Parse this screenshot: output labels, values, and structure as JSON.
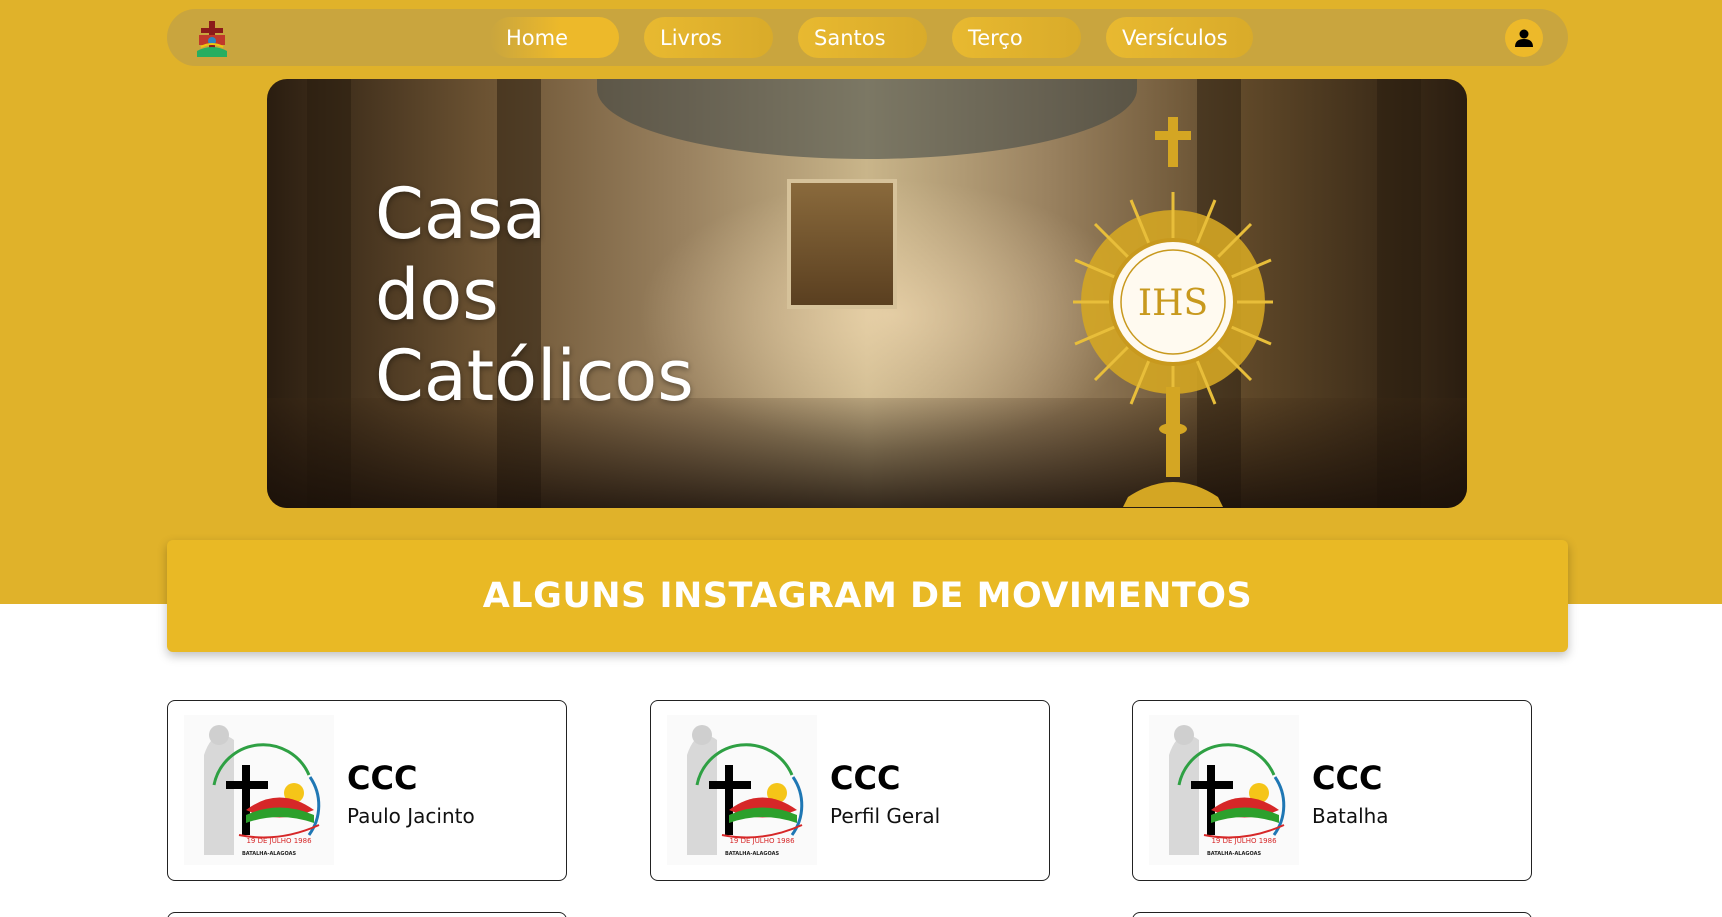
{
  "nav": {
    "logo_icon": "cross-emblem-icon",
    "links": [
      {
        "label": "Home"
      },
      {
        "label": "Livros"
      },
      {
        "label": "Santos"
      },
      {
        "label": "Terço"
      },
      {
        "label": "Versículos"
      }
    ],
    "user_icon": "user-icon"
  },
  "hero": {
    "title_lines": [
      "Casa",
      "dos",
      "Católicos"
    ],
    "monstrance_text": "IHS"
  },
  "section": {
    "title": "ALGUNS INSTAGRAM DE MOVIMENTOS"
  },
  "cards": [
    {
      "title": "CCC",
      "subtitle": "Paulo Jacinto",
      "logo_icon": "caminhada-comunitaria-logo"
    },
    {
      "title": "CCC",
      "subtitle": "Perfil Geral",
      "logo_icon": "caminhada-comunitaria-logo"
    },
    {
      "title": "CCC",
      "subtitle": "Batalha",
      "logo_icon": "caminhada-comunitaria-logo"
    }
  ],
  "logo_text": {
    "arc": "CAMINHADA COMUNITÁRIA COM CRISTO",
    "date": "19 DE JULHO 1986",
    "place": "BATALHA-ALAGOAS"
  },
  "colors": {
    "primary": "#e0b22a",
    "nav_bg": "#c9a53e",
    "header": "#e9b925"
  }
}
